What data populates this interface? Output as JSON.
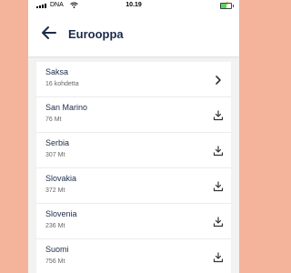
{
  "status_bar": {
    "carrier": "DNA",
    "time": "10.19",
    "icons": [
      "signal-icon",
      "wifi-icon",
      "battery-charging-icon"
    ]
  },
  "header": {
    "title": "Eurooppa",
    "back_icon": "back-arrow-icon"
  },
  "rows": [
    {
      "name": "Saksa",
      "sub": "16 kohdetta",
      "icon": "chevron-right-icon"
    },
    {
      "name": "San Marino",
      "sub": "76 Mt",
      "icon": "download-icon"
    },
    {
      "name": "Serbia",
      "sub": "307 Mt",
      "icon": "download-icon"
    },
    {
      "name": "Slovakia",
      "sub": "372 Mt",
      "icon": "download-icon"
    },
    {
      "name": "Slovenia",
      "sub": "236 Mt",
      "icon": "download-icon"
    },
    {
      "name": "Suomi",
      "sub": "756 Mt",
      "icon": "download-icon"
    }
  ],
  "colors": {
    "border_background": "#f4b49b",
    "title_text": "#1c2b4a",
    "battery_fill": "#4cd964"
  }
}
